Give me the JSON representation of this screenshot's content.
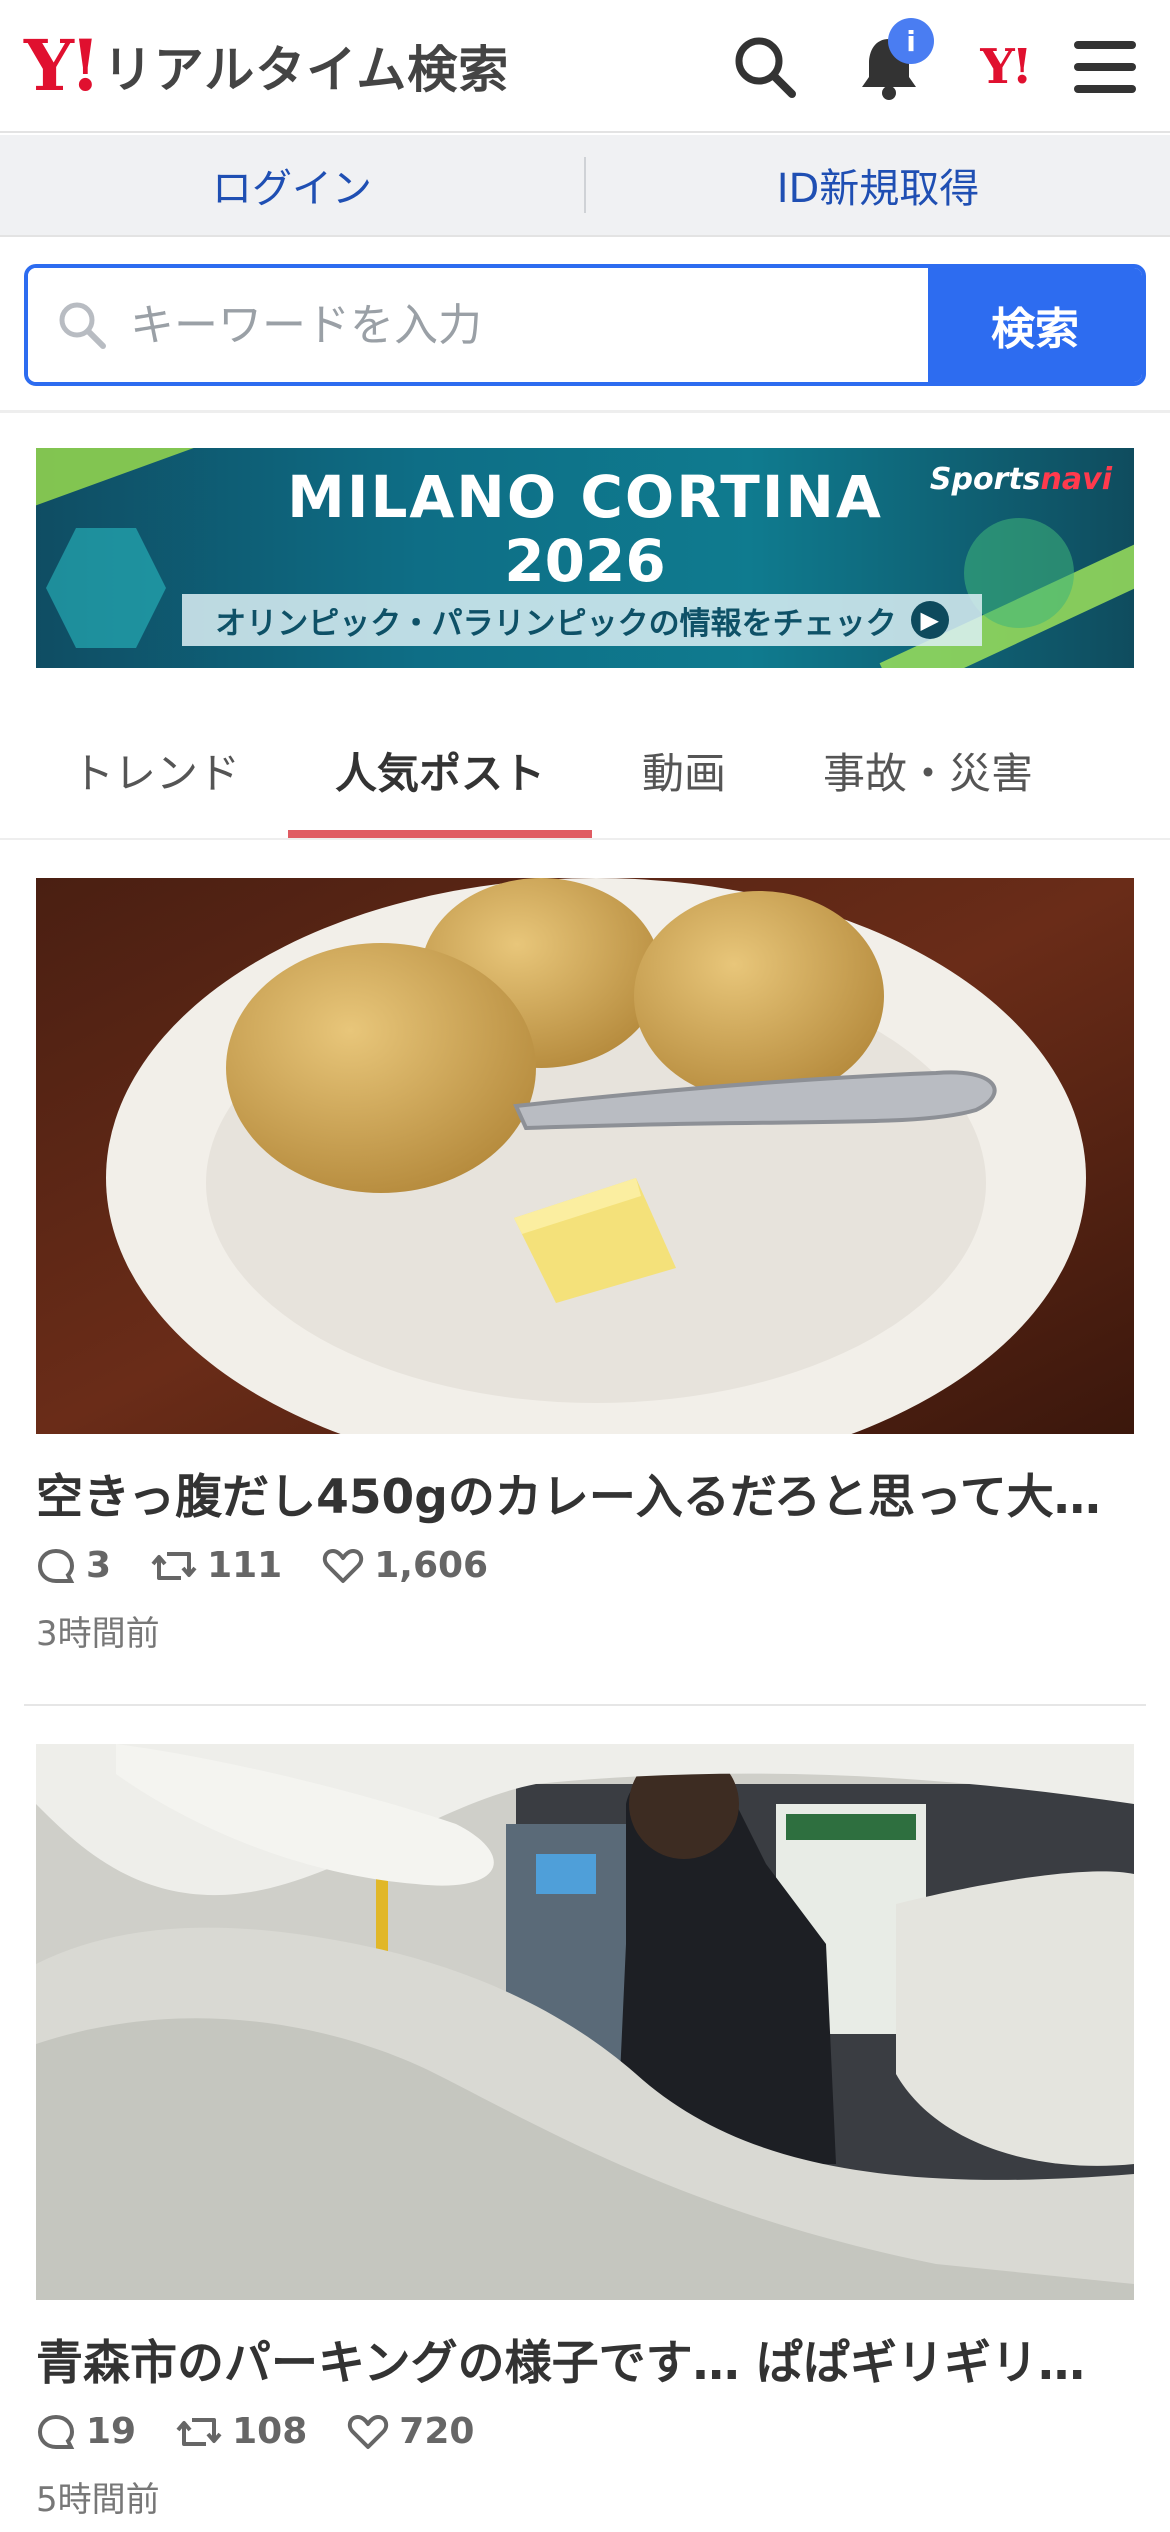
{
  "header": {
    "logo_mark": "Y!",
    "logo_text": "リアルタイム検索",
    "notification_badge": "i",
    "yahoo_mark": "Y!"
  },
  "account_bar": {
    "login_label": "ログイン",
    "signup_label": "ID新規取得"
  },
  "search": {
    "placeholder": "キーワードを入力",
    "value": "",
    "button_label": "検索"
  },
  "banner": {
    "title": "MILANO CORTINA",
    "year": "2026",
    "subtitle": "オリンピック・パラリンピックの情報をチェック",
    "brand_main": "Sports",
    "brand_accent": "navi"
  },
  "tabs": [
    {
      "label": "トレンド",
      "active": false
    },
    {
      "label": "人気ポスト",
      "active": true
    },
    {
      "label": "動画",
      "active": false
    },
    {
      "label": "事故・災害",
      "active": false
    }
  ],
  "posts": [
    {
      "title": "空きっ腹だし450gのカレー入るだろと思って大…",
      "replies": "3",
      "reposts": "111",
      "likes": "1,606",
      "time": "3時間前"
    },
    {
      "title": "青森市のパーキングの様子です… ぱぱギリギリ…",
      "replies": "19",
      "reposts": "108",
      "likes": "720",
      "time": "5時間前"
    }
  ],
  "colors": {
    "brand_red": "#e0102f",
    "link_blue": "#1f4fb3",
    "search_blue": "#2d6cf0",
    "tab_underline": "#e05c63"
  }
}
